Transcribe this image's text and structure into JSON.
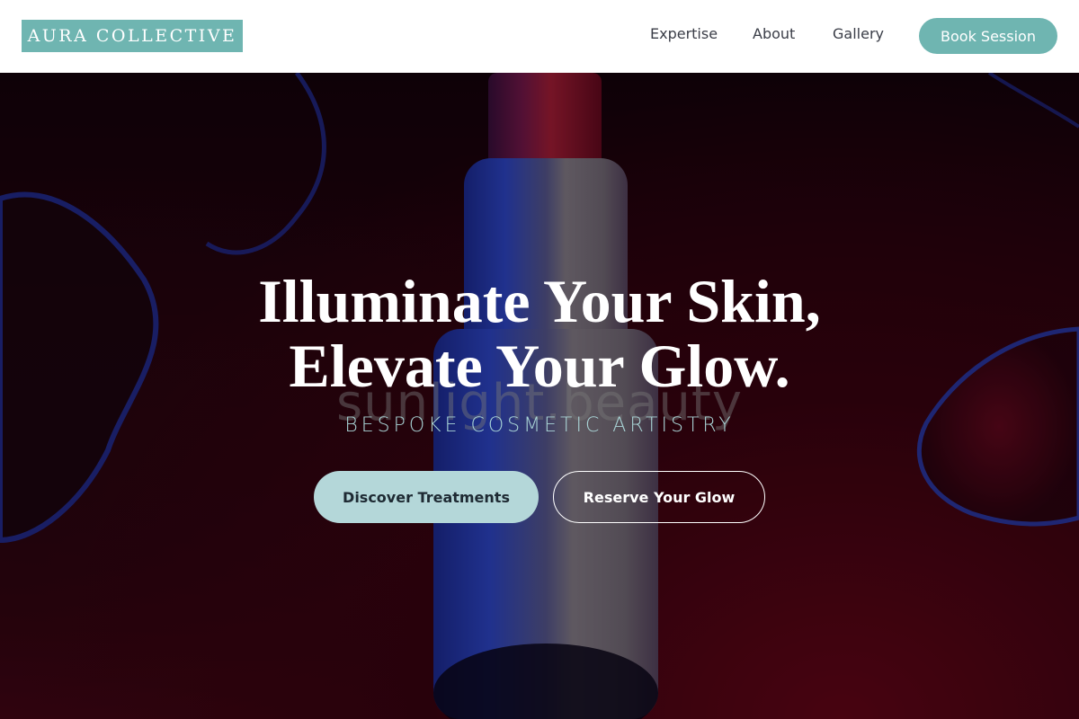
{
  "header": {
    "logo_text": "AURA COLLECTIVE",
    "nav": {
      "expertise": "Expertise",
      "about": "About",
      "gallery": "Gallery"
    },
    "cta_label": "Book Session"
  },
  "hero": {
    "title_line1": "Illuminate Your Skin,",
    "title_line2": "Elevate Your Glow.",
    "watermark": "sunlight.beauty",
    "subtitle": "BESPOKE COSMETIC ARTISTRY",
    "primary_button": "Discover Treatments",
    "secondary_button": "Reserve Your Glow"
  },
  "colors": {
    "brand_teal": "#6fb5b1",
    "button_light_teal": "#b4d7d9",
    "subtitle_teal": "#a9d4d6",
    "nav_text": "#3a3d47",
    "hero_background": "#2a0410"
  }
}
